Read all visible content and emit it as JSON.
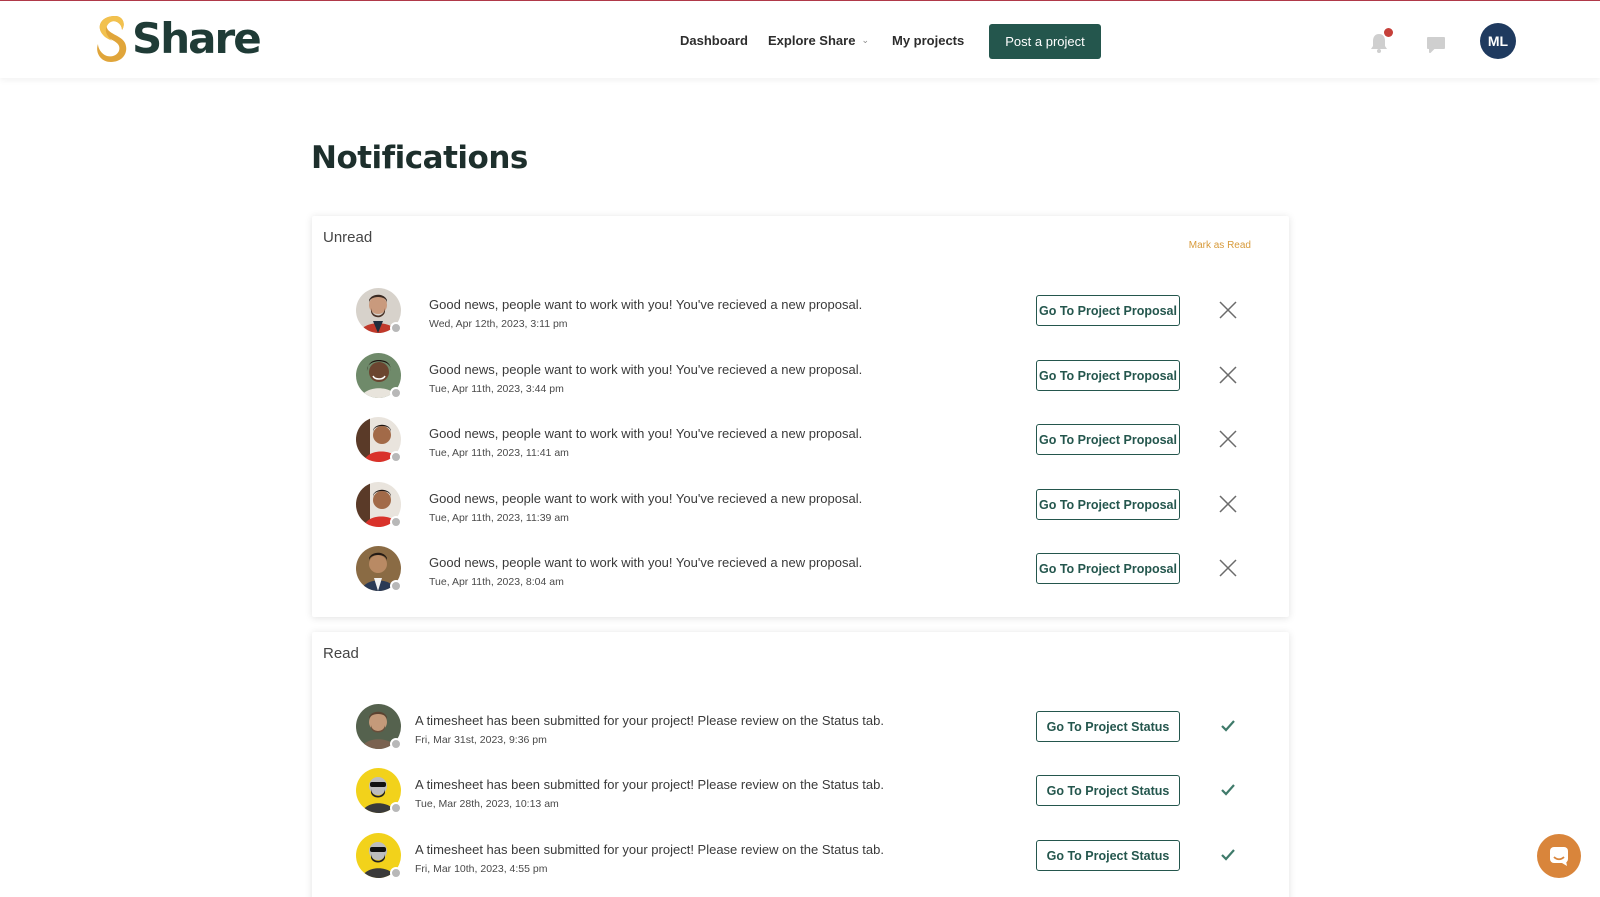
{
  "header": {
    "logo_text": "Share",
    "nav": [
      {
        "label": "Dashboard"
      },
      {
        "label": "Explore Share"
      },
      {
        "label": "My projects"
      }
    ],
    "post_button": "Post a project",
    "user_initials": "ML"
  },
  "page": {
    "title": "Notifications"
  },
  "unread": {
    "title": "Unread",
    "mark_as_read": "Mark as Read",
    "items": [
      {
        "message": "Good news, people want to work with you! You've recieved a new proposal.",
        "time": "Wed, Apr 12th, 2023, 3:11 pm",
        "action": "Go To Project Proposal"
      },
      {
        "message": "Good news, people want to work with you! You've recieved a new proposal.",
        "time": "Tue, Apr 11th, 2023, 3:44 pm",
        "action": "Go To Project Proposal"
      },
      {
        "message": "Good news, people want to work with you! You've recieved a new proposal.",
        "time": "Tue, Apr 11th, 2023, 11:41 am",
        "action": "Go To Project Proposal"
      },
      {
        "message": "Good news, people want to work with you! You've recieved a new proposal.",
        "time": "Tue, Apr 11th, 2023, 11:39 am",
        "action": "Go To Project Proposal"
      },
      {
        "message": "Good news, people want to work with you! You've recieved a new proposal.",
        "time": "Tue, Apr 11th, 2023, 8:04 am",
        "action": "Go To Project Proposal"
      }
    ]
  },
  "read": {
    "title": "Read",
    "items": [
      {
        "message": "A timesheet has been submitted for your project! Please review on the Status tab.",
        "time": "Fri, Mar 31st, 2023, 9:36 pm",
        "action": "Go To Project Status"
      },
      {
        "message": "A timesheet has been submitted for your project! Please review on the Status tab.",
        "time": "Tue, Mar 28th, 2023, 10:13 am",
        "action": "Go To Project Status"
      },
      {
        "message": "A timesheet has been submitted for your project! Please review on the Status tab.",
        "time": "Fri, Mar 10th, 2023, 4:55 pm",
        "action": "Go To Project Status"
      }
    ]
  },
  "colors": {
    "brand_dark": "#24564d",
    "logo_gold": "#e0a53a",
    "accent_orange": "#d9853b",
    "notification_dot": "#c6403a",
    "avatar_bg": "#1f3a5f"
  },
  "icons": [
    "bell-icon",
    "chat-icon",
    "close-icon",
    "check-icon",
    "chevron-down-icon",
    "help-chat-icon"
  ]
}
